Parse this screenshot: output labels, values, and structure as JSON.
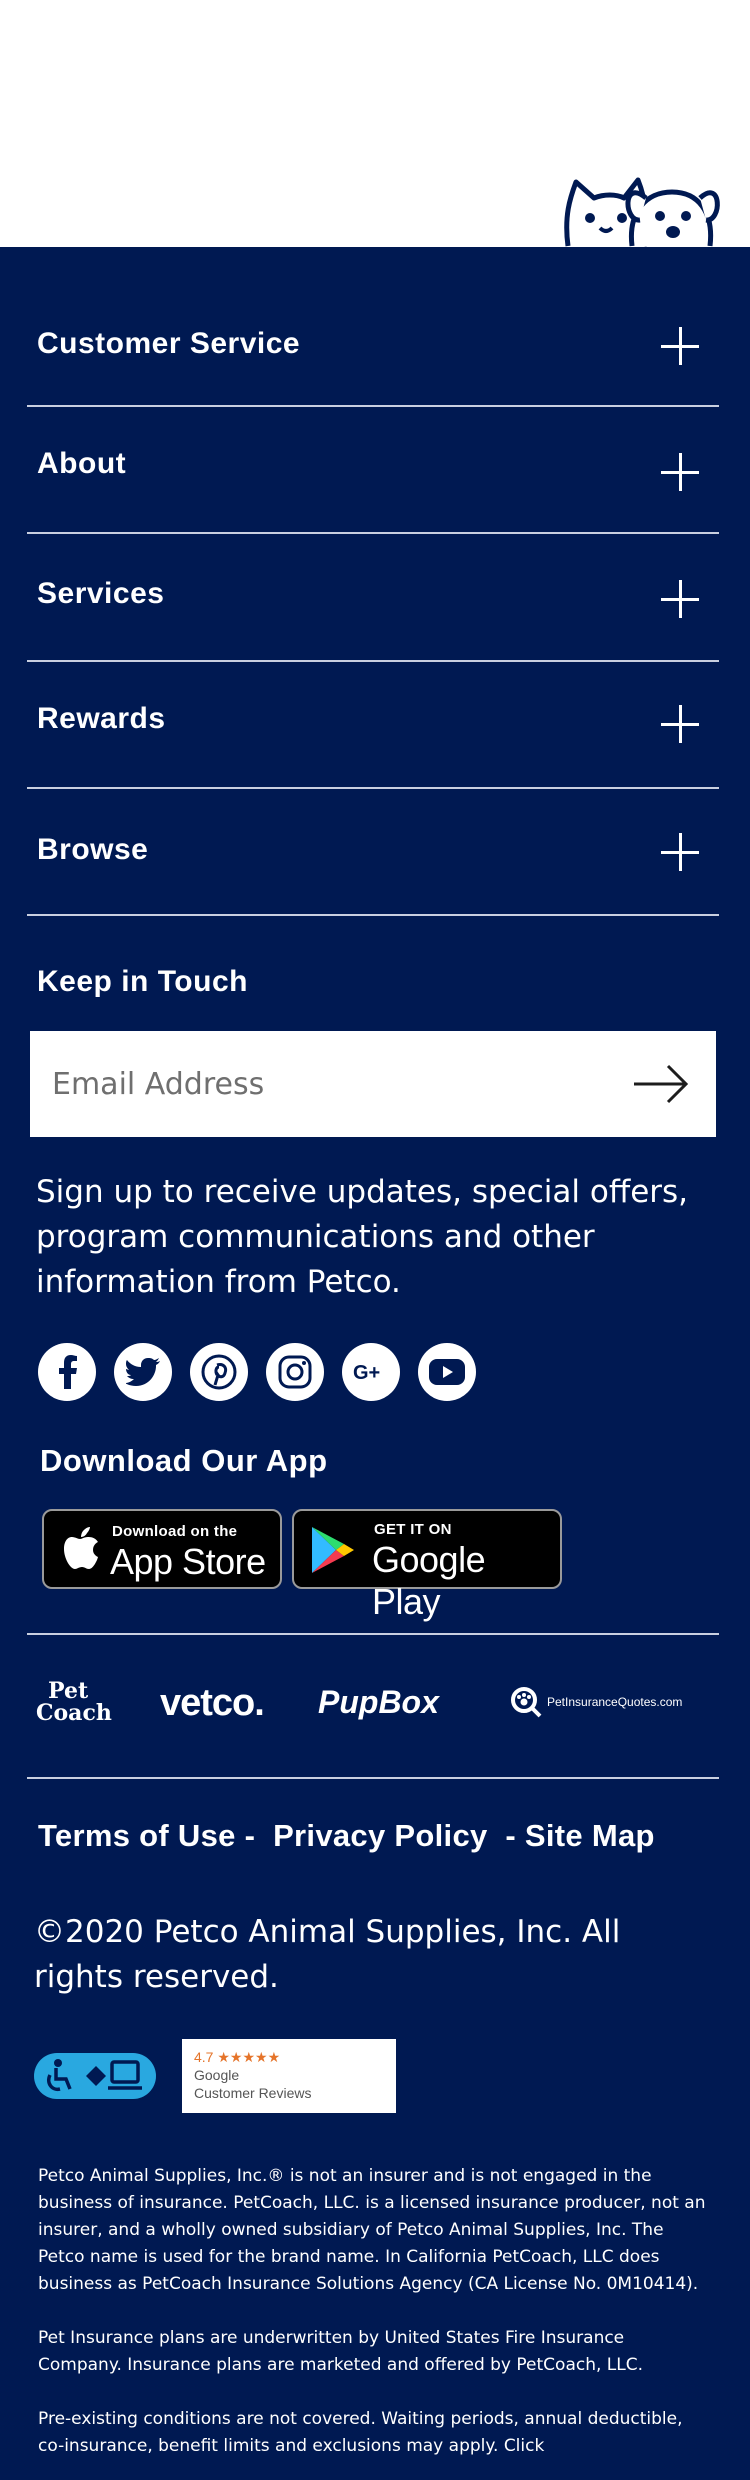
{
  "accordion": [
    {
      "label": "Customer Service"
    },
    {
      "label": "About"
    },
    {
      "label": "Services"
    },
    {
      "label": "Rewards"
    },
    {
      "label": "Browse"
    }
  ],
  "keep_in_touch": {
    "title": "Keep in Touch",
    "email_placeholder": "Email Address",
    "signup_text": "Sign up to receive updates, special offers, program communications and other information from Petco."
  },
  "social": [
    "facebook-icon",
    "twitter-icon",
    "pinterest-icon",
    "instagram-icon",
    "google-plus-icon",
    "youtube-icon"
  ],
  "app": {
    "title": "Download Our App",
    "app_store_small": "Download on the",
    "app_store_big": "App Store",
    "google_small": "GET IT ON",
    "google_big": "Google Play"
  },
  "brands": {
    "petcoach_line1": "Pet",
    "petcoach_line2": "Coach",
    "vetco": "vetco.",
    "pupbox": "PupBox",
    "petinsurancequotes": "PetInsuranceQuotes.com"
  },
  "legal": {
    "terms": "Terms of Use",
    "privacy": "Privacy Policy",
    "sitemap": "Site Map",
    "sep": "-",
    "copyright": "©2020 Petco Animal Supplies, Inc. All rights reserved."
  },
  "reviews": {
    "rating": "4.7",
    "stars": "★★★★★",
    "source": "Google",
    "label": "Customer Reviews"
  },
  "disclaimer": {
    "p1": "Petco Animal Supplies, Inc.® is not an insurer and is not engaged in the business of insurance. PetCoach, LLC. is a licensed insurance producer, not an insurer, and a wholly owned subsidiary of Petco Animal Supplies, Inc. The Petco name is used for the brand name. In California PetCoach, LLC does business as PetCoach Insurance Solutions Agency (CA License No. 0M10414).",
    "p2": "Pet Insurance plans are underwritten by United States Fire Insurance Company. Insurance plans are marketed and offered by PetCoach, LLC.",
    "p3": "Pre-existing conditions are not covered. Waiting periods, annual deductible, co-insurance, benefit limits and exclusions may apply. Click"
  },
  "colors": {
    "footer_bg": "#001952",
    "accent_blue": "#29a8e0",
    "divider": "#c9cfe0"
  }
}
